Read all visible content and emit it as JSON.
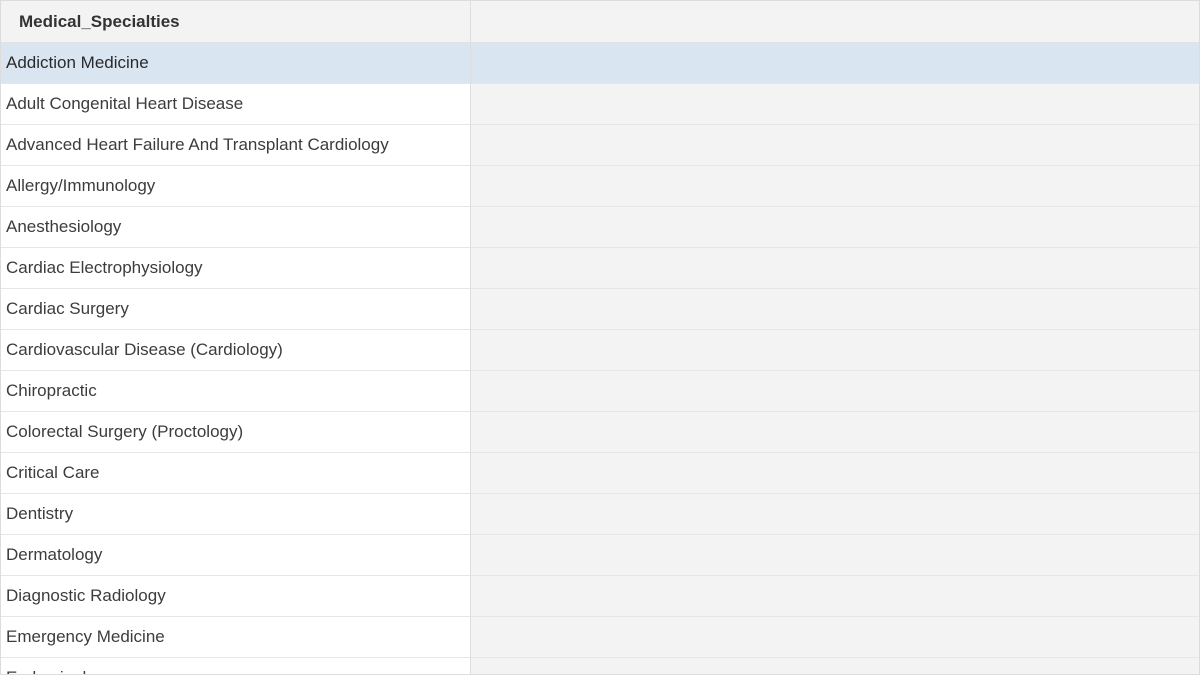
{
  "table": {
    "column_header": "Medical_Specialties",
    "selected_index": 0,
    "rows": [
      "Addiction Medicine",
      "Adult Congenital Heart Disease",
      "Advanced Heart Failure And Transplant Cardiology",
      "Allergy/Immunology",
      "Anesthesiology",
      "Cardiac Electrophysiology",
      "Cardiac Surgery",
      "Cardiovascular Disease (Cardiology)",
      "Chiropractic",
      "Colorectal Surgery (Proctology)",
      "Critical Care",
      "Dentistry",
      "Dermatology",
      "Diagnostic Radiology",
      "Emergency Medicine",
      "Endocrinology"
    ]
  },
  "colors": {
    "selected_row": "#d9e5f0",
    "background": "#f3f3f3",
    "cell": "#ffffff"
  }
}
